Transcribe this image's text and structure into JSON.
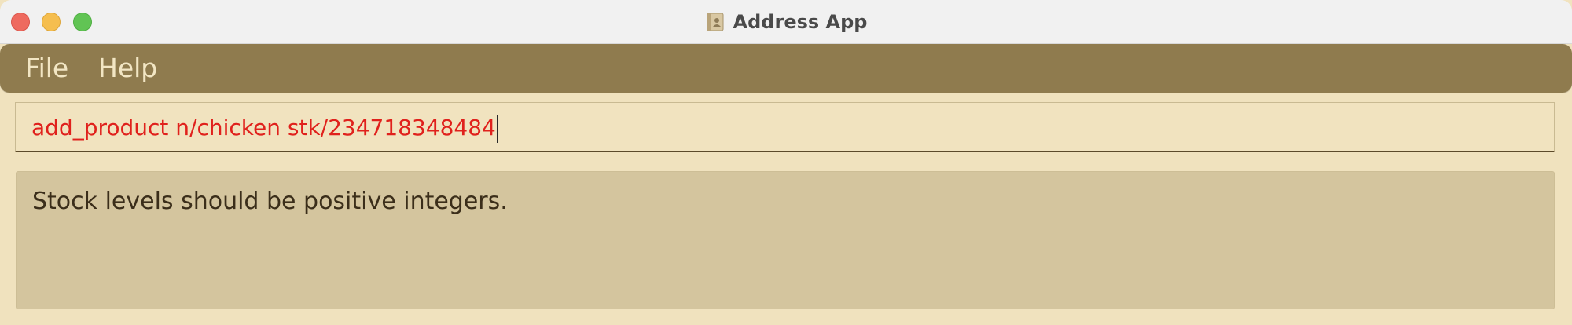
{
  "window": {
    "title": "Address App",
    "app_icon": "address-book-icon"
  },
  "menu": {
    "items": [
      {
        "label": "File"
      },
      {
        "label": "Help"
      }
    ]
  },
  "command_box": {
    "value": "add_product n/chicken stk/234718348484",
    "text_color": "#E0211C"
  },
  "result_display": {
    "message": "Stock levels should be positive integers."
  },
  "colors": {
    "menu_bar": "#8F7B4E",
    "background": "#F0E2BE",
    "result_background": "#D4C59E"
  }
}
